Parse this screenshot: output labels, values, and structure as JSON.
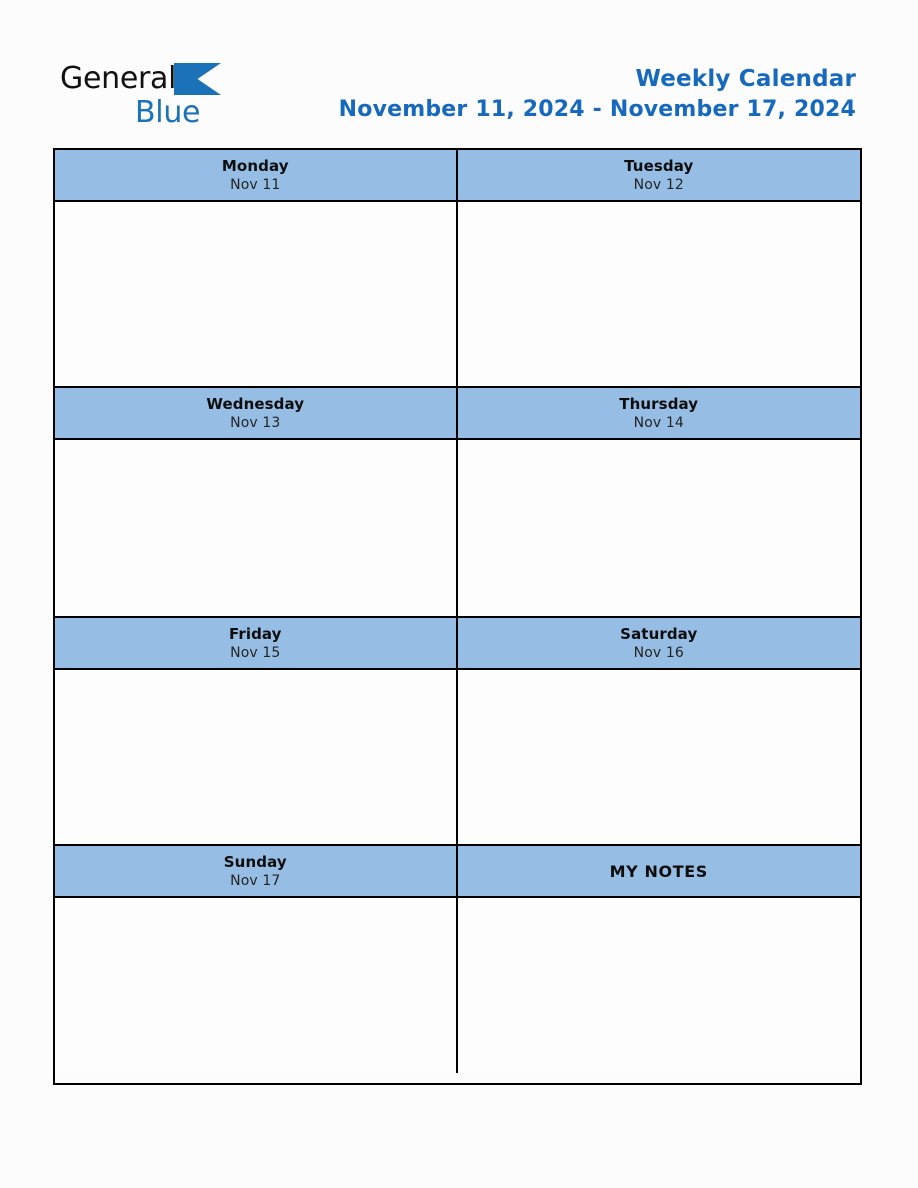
{
  "page": {
    "background_color": "#fcfcfc"
  },
  "brand": {
    "name_part1": "General",
    "name_part2": "Blue",
    "triangle_color": "#1B72B8",
    "text_color_part1": "#111111",
    "text_color_part2": "#1B72B8"
  },
  "header": {
    "title": "Weekly Calendar",
    "date_range": "November 11, 2024 - November 17, 2024",
    "title_color": "#1669BC"
  },
  "calendar": {
    "header_fill_color": "#96BDE4",
    "border_color": "#000000",
    "blocks": [
      {
        "left": {
          "day": "Monday",
          "date": "Nov 11",
          "note_content": ""
        },
        "right": {
          "day": "Tuesday",
          "date": "Nov 12",
          "note_content": ""
        }
      },
      {
        "left": {
          "day": "Wednesday",
          "date": "Nov 13",
          "note_content": ""
        },
        "right": {
          "day": "Thursday",
          "date": "Nov 14",
          "note_content": ""
        }
      },
      {
        "left": {
          "day": "Friday",
          "date": "Nov 15",
          "note_content": ""
        },
        "right": {
          "day": "Saturday",
          "date": "Nov 16",
          "note_content": ""
        }
      },
      {
        "left": {
          "day": "Sunday",
          "date": "Nov 17",
          "note_content": ""
        },
        "right": {
          "day": "MY NOTES",
          "date": "",
          "note_content": ""
        }
      }
    ]
  }
}
